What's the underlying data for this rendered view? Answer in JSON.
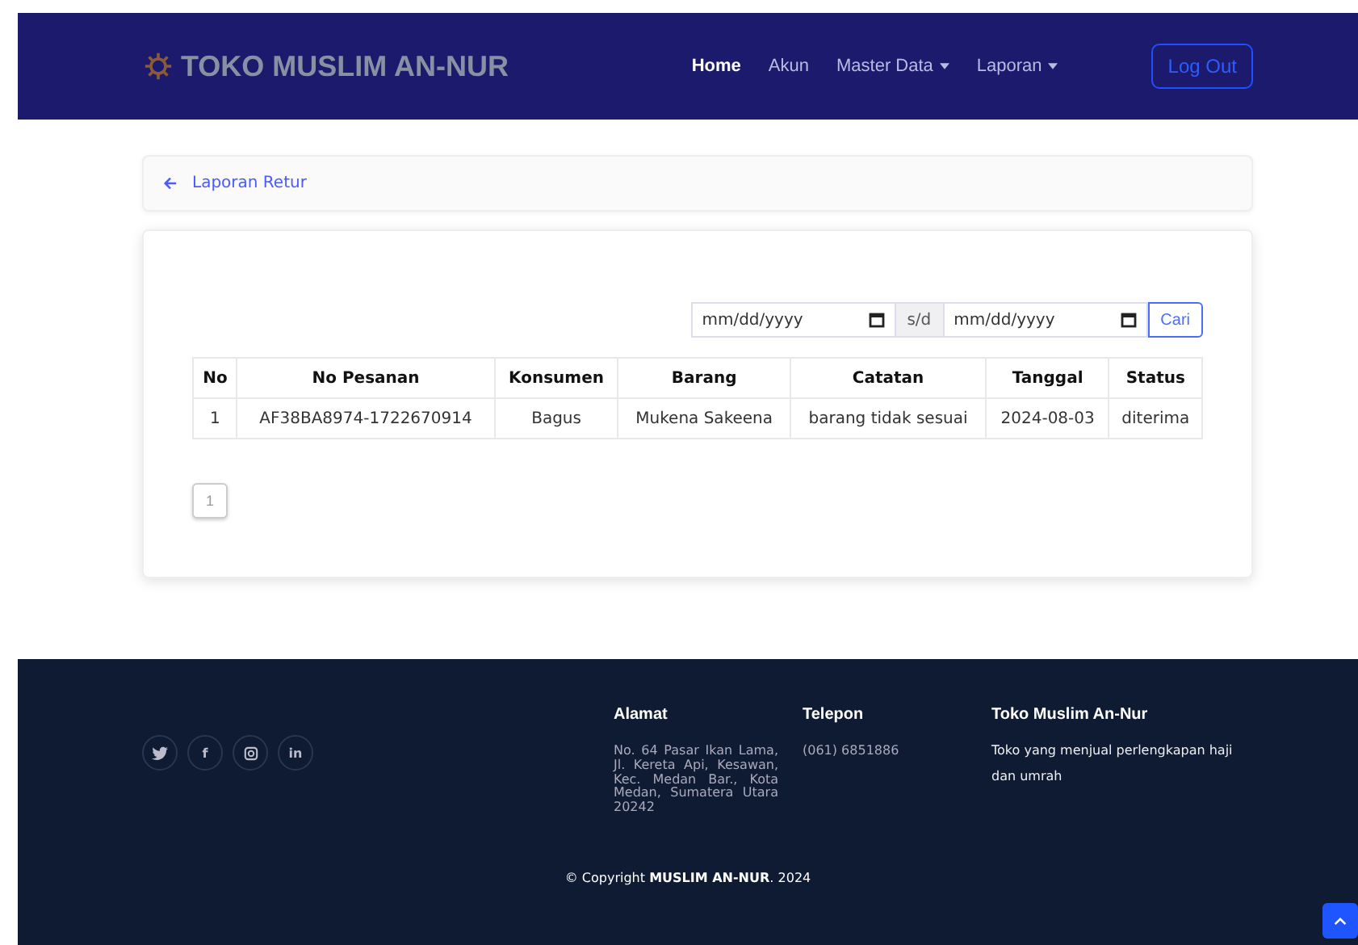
{
  "navbar": {
    "brand": "TOKO MUSLIM AN-NUR",
    "links": [
      {
        "label": "Home",
        "selected": true,
        "dropdown": false
      },
      {
        "label": "Akun",
        "selected": false,
        "dropdown": false
      },
      {
        "label": "Master Data",
        "selected": false,
        "dropdown": true
      },
      {
        "label": "Laporan",
        "selected": false,
        "dropdown": true
      }
    ],
    "logout": "Log Out"
  },
  "breadcrumb": {
    "title": "Laporan Retur"
  },
  "filter": {
    "start_placeholder": "mm/dd/yyyy",
    "separator": "s/d",
    "end_placeholder": "mm/dd/yyyy",
    "button": "Cari"
  },
  "table": {
    "columns": [
      "No",
      "No Pesanan",
      "Konsumen",
      "Barang",
      "Catatan",
      "Tanggal",
      "Status"
    ],
    "rows": [
      [
        "1",
        "AF38BA8974-1722670914",
        "Bagus",
        "Mukena Sakeena",
        "barang tidak sesuai",
        "2024-08-03",
        "diterima"
      ]
    ]
  },
  "pagination": [
    {
      "label": "1",
      "selected": true
    }
  ],
  "footer": {
    "social": [
      {
        "kind": "twitter"
      },
      {
        "kind": "facebook",
        "glyph": "f"
      },
      {
        "kind": "instagram"
      },
      {
        "kind": "linkedin",
        "glyph": "in"
      }
    ],
    "columns": [
      {
        "title": "Alamat",
        "text": "No. 64 Pasar Ikan Lama, Jl. Kereta Api, Kesawan, Kec. Medan Bar., Kota Medan, Sumatera Utara 20242",
        "kind": "address"
      },
      {
        "title": "Telepon",
        "text": "(061) 6851886",
        "kind": "phone"
      },
      {
        "title": "Toko Muslim An-Nur",
        "text": "Toko yang menjual perlengkapan haji dan umrah",
        "kind": "about"
      }
    ],
    "copyright": "© Copyright **MUSLIM AN-NUR**. 2024"
  }
}
